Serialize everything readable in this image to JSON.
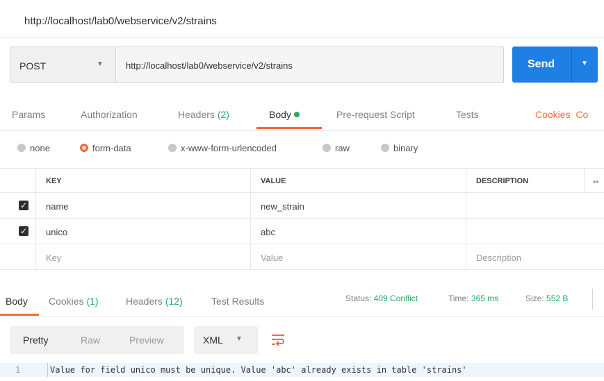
{
  "title": "http://localhost/lab0/webservice/v2/strains",
  "request": {
    "method": "POST",
    "url": "http://localhost/lab0/webservice/v2/strains",
    "send_label": "Send"
  },
  "request_tabs": {
    "params": "Params",
    "authorization": "Authorization",
    "headers": "Headers",
    "headers_count": "(2)",
    "body": "Body",
    "pre_request": "Pre-request Script",
    "tests": "Tests",
    "cookies": "Cookies",
    "code": "Co"
  },
  "body_types": [
    "none",
    "form-data",
    "x-www-form-urlencoded",
    "raw",
    "binary"
  ],
  "body_type_selected": "form-data",
  "table": {
    "columns": [
      "KEY",
      "VALUE",
      "DESCRIPTION"
    ],
    "rows": [
      {
        "checked": true,
        "key": "name",
        "value": "new_strain",
        "description": ""
      },
      {
        "checked": true,
        "key": "unico",
        "value": "abc",
        "description": ""
      }
    ],
    "placeholder": {
      "key": "Key",
      "value": "Value",
      "description": "Description"
    }
  },
  "response_tabs": {
    "body": "Body",
    "cookies": "Cookies",
    "cookies_count": "(1)",
    "headers": "Headers",
    "headers_count": "(12)",
    "test_results": "Test Results"
  },
  "status": {
    "status_label": "Status:",
    "status_value": "409 Conflict",
    "time_label": "Time:",
    "time_value": "365 ms",
    "size_label": "Size:",
    "size_value": "552 B"
  },
  "view": {
    "pretty": "Pretty",
    "raw": "Raw",
    "preview": "Preview",
    "format": "XML",
    "wrap_icon": "wrap-lines-icon"
  },
  "response_body": {
    "line_number": "1",
    "text": "Value for field unico must be unique. Value 'abc' already exists in table 'strains'"
  },
  "colors": {
    "accent": "#f26b3a",
    "send": "#1e80e5",
    "success": "#27a85f"
  }
}
